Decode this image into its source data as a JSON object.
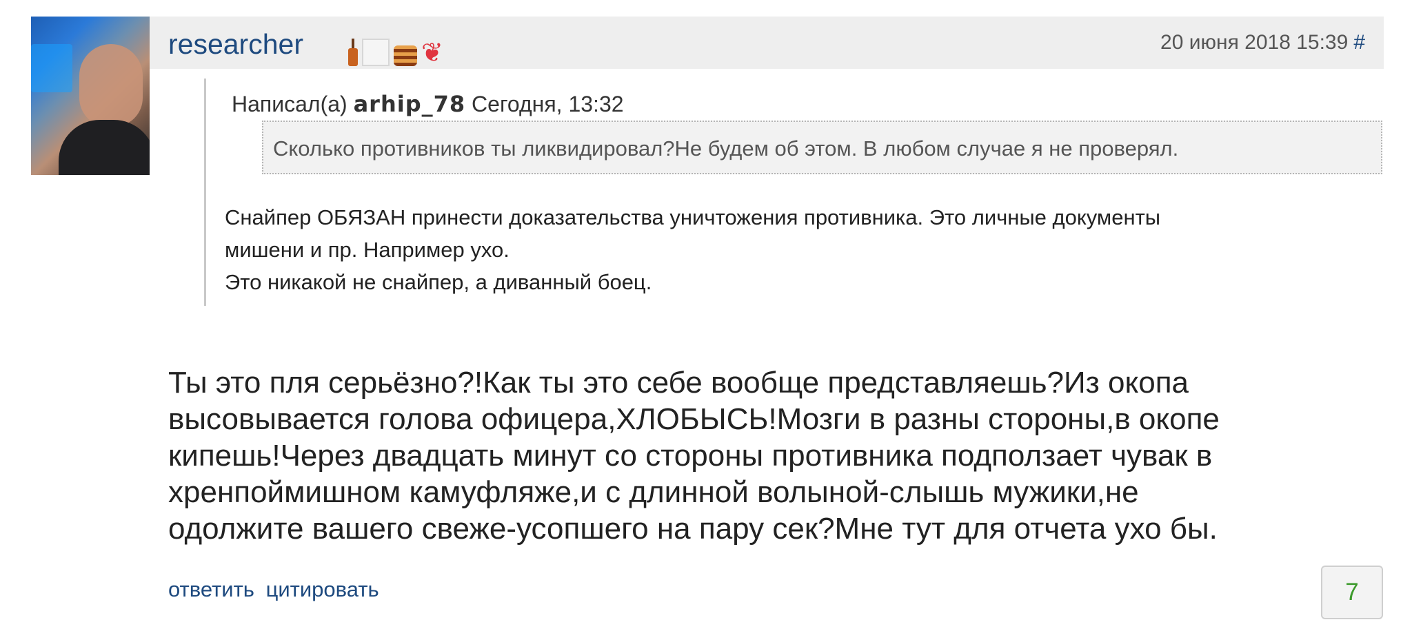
{
  "post": {
    "author": "researcher",
    "timestamp": "20 июня 2018 15:39",
    "permalink": "#",
    "badges": [
      "bottle-icon",
      "empty-badge",
      "cake-icon",
      "heart-icon"
    ],
    "quote": {
      "prefix": "Написал(а)",
      "author": "arhip_78",
      "time": "Сегодня, 13:32",
      "nested_text": "Сколько противников ты ликвидировал?Не будем об этом. В любом случае я не проверял.",
      "lines": [
        "Снайпер ОБЯЗАН принести доказательства уничтожения противника. Это личные документы",
        "мишени и пр. Например ухо.",
        "Это никакой не снайпер, а диванный боец."
      ]
    },
    "body_lines": [
      "Ты это пля серьёзно?!Как ты это себе вообще представляешь?Из окопа",
      "высовывается голова офицера,ХЛОБЫСЬ!Мозги в разны стороны,в окопе",
      "кипешь!Через двадцать минут со стороны противника подползает чувак в",
      "хренпоймишном камуфляже,и с длинной волыной-слышь мужики,не",
      "одолжите вашего свеже-усопшего на пару сек?Мне тут для отчета ухо бы."
    ],
    "actions": {
      "reply": "ответить",
      "quote": "цитировать"
    },
    "rating": "7"
  },
  "colors": {
    "link": "#1e4a7f",
    "header_bg": "#eeeeee",
    "rating": "#3c9a2c"
  }
}
